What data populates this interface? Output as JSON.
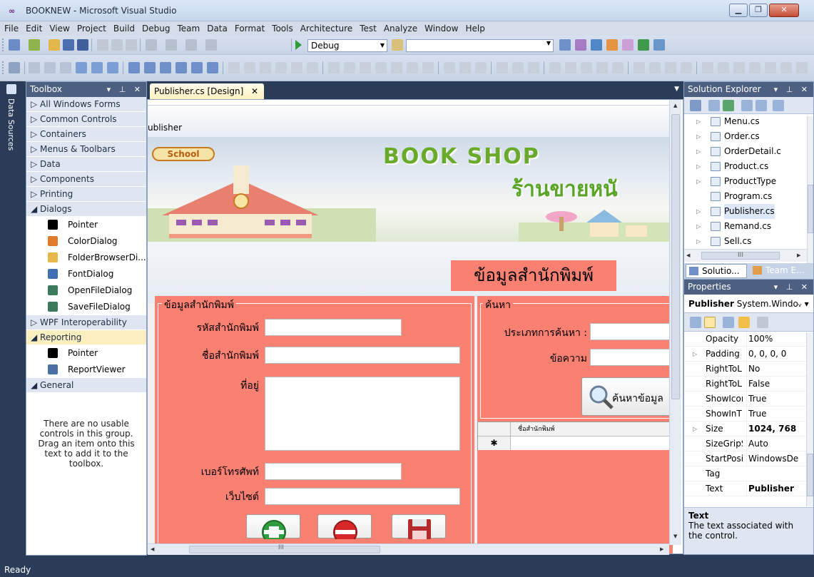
{
  "window": {
    "title": "BOOKNEW - Microsoft Visual Studio",
    "min_label": "▁",
    "max_label": "❐",
    "close_label": "✕"
  },
  "menu": [
    "File",
    "Edit",
    "View",
    "Project",
    "Build",
    "Debug",
    "Team",
    "Data",
    "Format",
    "Tools",
    "Architecture",
    "Test",
    "Analyze",
    "Window",
    "Help"
  ],
  "toolbar": {
    "config": "Debug",
    "find_value": ""
  },
  "data_sources": {
    "label": "Data Sources"
  },
  "toolbox": {
    "title": "Toolbox",
    "controls": "▾ ⊥ ✕",
    "groups_top": [
      "▷ All Windows Forms",
      "▷ Common Controls",
      "▷ Containers",
      "▷ Menus & Toolbars",
      "▷ Data",
      "▷ Components",
      "▷ Printing"
    ],
    "dialogs": {
      "header": "◢ Dialogs",
      "items": [
        {
          "label": "Pointer",
          "icon": "pointer-icon",
          "color": "#000000"
        },
        {
          "label": "ColorDialog",
          "icon": "color-dialog-icon",
          "color": "#e07b2a"
        },
        {
          "label": "FolderBrowserDi...",
          "icon": "folder-browser-icon",
          "color": "#e6b84a"
        },
        {
          "label": "FontDialog",
          "icon": "font-dialog-icon",
          "color": "#3f6fb5"
        },
        {
          "label": "OpenFileDialog",
          "icon": "open-file-icon",
          "color": "#3a7a5a"
        },
        {
          "label": "SaveFileDialog",
          "icon": "save-file-icon",
          "color": "#3a7a5a"
        }
      ]
    },
    "wpf_group": "▷ WPF Interoperability",
    "reporting": {
      "header": "◢ Reporting",
      "items": [
        {
          "label": "Pointer",
          "icon": "pointer-icon",
          "color": "#000000"
        },
        {
          "label": "ReportViewer",
          "icon": "report-viewer-icon",
          "color": "#4a6fa5"
        }
      ]
    },
    "general": {
      "header": "◢ General",
      "empty_text": "There are no usable controls in this group. Drag an item onto this text to add it to the toolbox."
    }
  },
  "document": {
    "tab_label": "Publisher.cs [Design]",
    "tab_close": "✕",
    "form_caption": "ublisher",
    "banner_school": "School",
    "banner_title_en": "BOOK SHOP",
    "banner_title_th": "ร้านขายหนั",
    "section_heading": "ข้อมูลสำนักพิมพ์",
    "publisher_group": {
      "title": "ข้อมูลสำนักพิมพ์",
      "fields": [
        {
          "label": "รหัสสำนักพิมพ์",
          "value": ""
        },
        {
          "label": "ชื่อสำนักพิมพ์",
          "value": ""
        },
        {
          "label": "ที่อยู่",
          "value": ""
        },
        {
          "label": "เบอร์โทรศัพท์",
          "value": ""
        },
        {
          "label": "เว็บไซต์",
          "value": ""
        }
      ]
    },
    "search_group": {
      "title": "ค้นหา",
      "type_label": "ประเภทการค้นหา :",
      "text_label": "ข้อความ",
      "type_value": "",
      "text_value": "",
      "button_label": "ค้นหาข้อมูล"
    },
    "grid": {
      "column_header": "ชื่อสำนักพิมพ์",
      "new_row_marker": "✱"
    },
    "buttons": [
      {
        "icon": "add-icon",
        "color": "#2e9e3e"
      },
      {
        "icon": "remove-icon",
        "color": "#d62828"
      },
      {
        "icon": "save-icon",
        "color": "#b52b2b"
      }
    ],
    "hscroll_label": "III"
  },
  "solution_explorer": {
    "title": "Solution Explorer",
    "controls": "▾ ⊥ ✕",
    "files": [
      {
        "name": "Menu.cs",
        "expandable": true
      },
      {
        "name": "Order.cs",
        "expandable": true
      },
      {
        "name": "OrderDetail.c",
        "expandable": true
      },
      {
        "name": "Product.cs",
        "expandable": true
      },
      {
        "name": "ProductType",
        "expandable": true
      },
      {
        "name": "Program.cs",
        "expandable": false
      },
      {
        "name": "Publisher.cs",
        "expandable": true
      },
      {
        "name": "Remand.cs",
        "expandable": true
      },
      {
        "name": "Sell.cs",
        "expandable": true
      }
    ],
    "hscroll_label": "III",
    "tabs": [
      "Solutio...",
      "Team E..."
    ]
  },
  "properties": {
    "title": "Properties",
    "controls": "▾ ⊥ ✕",
    "object_name": "Publisher",
    "object_type": "System.Windoᵥ ▾",
    "rows": [
      {
        "name": "Opacity",
        "value": "100%",
        "expand": false,
        "bold": false
      },
      {
        "name": "Padding",
        "value": "0, 0, 0, 0",
        "expand": true,
        "bold": false
      },
      {
        "name": "RightToL",
        "value": "No",
        "expand": false,
        "bold": false
      },
      {
        "name": "RightToL",
        "value": "False",
        "expand": false,
        "bold": false
      },
      {
        "name": "ShowIcoı",
        "value": "True",
        "expand": false,
        "bold": false
      },
      {
        "name": "ShowInT",
        "value": "True",
        "expand": false,
        "bold": false
      },
      {
        "name": "Size",
        "value": "1024, 768",
        "expand": true,
        "bold": true
      },
      {
        "name": "SizeGripS",
        "value": "Auto",
        "expand": false,
        "bold": false
      },
      {
        "name": "StartPosi",
        "value": "WindowsDe",
        "expand": false,
        "bold": false
      },
      {
        "name": "Tag",
        "value": "",
        "expand": false,
        "bold": false
      },
      {
        "name": "Text",
        "value": "Publisher",
        "expand": false,
        "bold": true
      }
    ],
    "desc_title": "Text",
    "desc_text": "The text associated with the control."
  },
  "status": {
    "text": "Ready"
  }
}
